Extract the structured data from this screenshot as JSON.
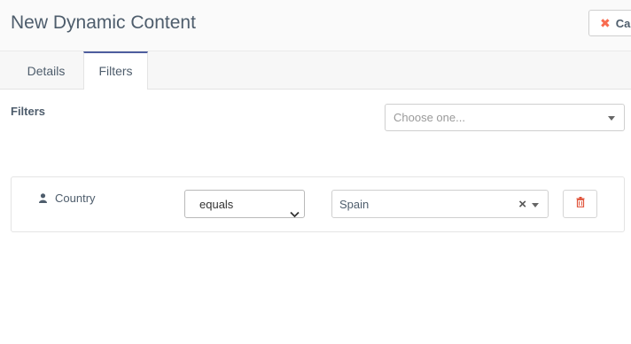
{
  "header": {
    "title": "New Dynamic Content",
    "cancel_label": "Can"
  },
  "tabs": [
    {
      "label": "Details",
      "active": false
    },
    {
      "label": "Filters",
      "active": true
    }
  ],
  "filters_section": {
    "label": "Filters",
    "add_filter_placeholder": "Choose one..."
  },
  "filter_row": {
    "field_icon": "user-icon",
    "field_label": "Country",
    "operator": "equals",
    "value": "Spain",
    "delete_icon": "trash-icon"
  },
  "colors": {
    "accent": "#4e5e9e",
    "danger": "#f86b4f",
    "text": "#4e5d6c"
  }
}
